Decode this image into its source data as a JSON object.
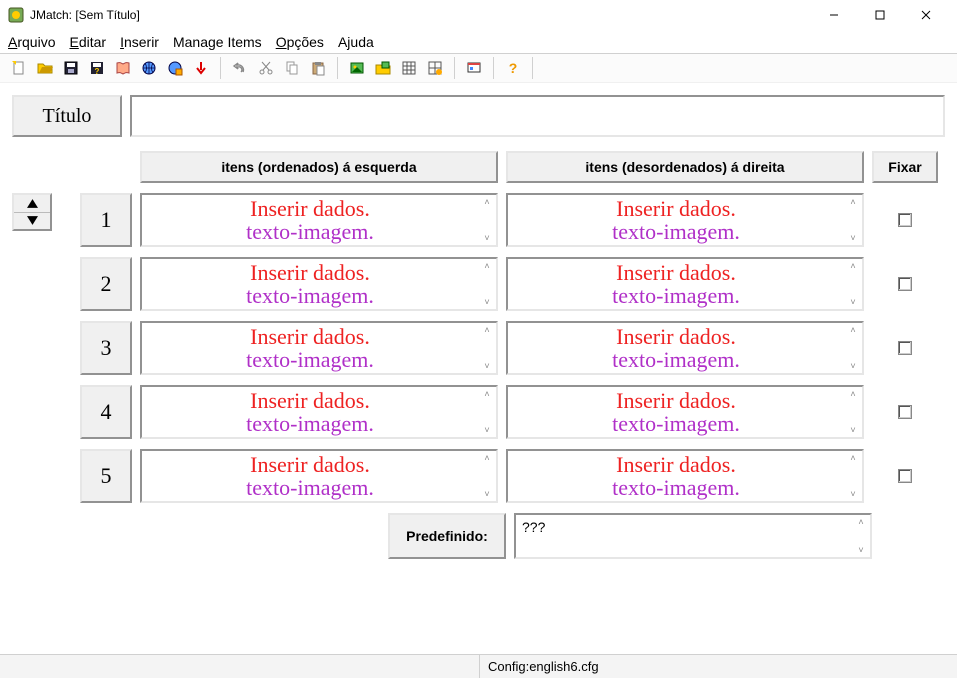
{
  "window": {
    "title": "JMatch: [Sem Título]"
  },
  "menu": {
    "arquivo": "Arquivo",
    "editar": "Editar",
    "inserir": "Inserir",
    "manage": "Manage Items",
    "opcoes": "Opções",
    "ajuda": "Ajuda"
  },
  "labels": {
    "titulo": "Título",
    "header_left": "itens (ordenados) á esquerda",
    "header_right": "itens (desordenados) á direita",
    "fixar": "Fixar",
    "predefinido": "Predefinido:",
    "predef_value": "???"
  },
  "cell_text": {
    "line1": "Inserir dados.",
    "line2": "texto-imagem."
  },
  "rows": {
    "n1": "1",
    "n2": "2",
    "n3": "3",
    "n4": "4",
    "n5": "5"
  },
  "status": {
    "config": "Config:english6.cfg"
  }
}
